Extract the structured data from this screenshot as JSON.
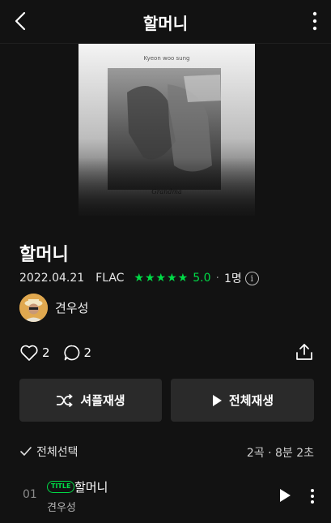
{
  "header": {
    "title": "할머니",
    "back_icon": "back-arrow-icon",
    "more_icon": "kebab-menu-icon"
  },
  "cover": {
    "artist_text": "Kyeon woo sung",
    "signature_text": "Grandma"
  },
  "album": {
    "title": "할머니",
    "date": "2022.04.21",
    "format": "FLAC",
    "stars": "★★★★★",
    "rating": "5.0",
    "separator": "·",
    "rating_count": "1명",
    "info_glyph": "i"
  },
  "artist": {
    "name": "견우성"
  },
  "social": {
    "likes": "2",
    "comments": "2"
  },
  "buttons": {
    "shuffle_label": "셔플재생",
    "play_all_label": "전체재생"
  },
  "selection": {
    "select_all_label": "전체선택",
    "summary": "2곡 · 8분 2초"
  },
  "tracks": [
    {
      "num": "01",
      "badge": "TITLE",
      "title": "할머니",
      "artist": "견우성"
    }
  ],
  "colors": {
    "accent_green": "#00dc47",
    "background": "#121212",
    "button_bg": "#2a2a2a"
  }
}
